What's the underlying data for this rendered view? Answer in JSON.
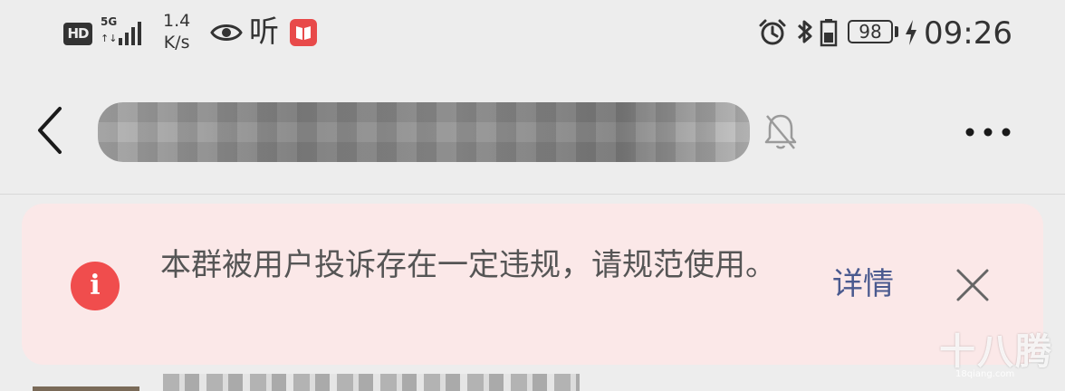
{
  "status_bar": {
    "hd_label": "HD",
    "network_label": "5G",
    "network_arrows": "↑↓",
    "net_speed_value": "1.4",
    "net_speed_unit": "K/s",
    "listen_label": "听",
    "battery_level": "98",
    "time": "09:26",
    "icons": [
      "hd-icon",
      "signal-icon",
      "eye-icon",
      "listen-icon",
      "book-app-icon",
      "alarm-icon",
      "bluetooth-icon",
      "battery-icon",
      "charging-icon"
    ]
  },
  "header": {
    "title": "",
    "back_icon": "chevron-left-icon",
    "mute_icon": "bell-off-icon",
    "more_label": "•••"
  },
  "banner": {
    "icon_glyph": "i",
    "message": "本群被用户投诉存在一定违规，请规范使用。",
    "detail_label": "详情",
    "close_icon": "close-icon",
    "colors": {
      "background": "#fbe8e8",
      "icon": "#f04d4d",
      "link": "#4a5a8f"
    }
  },
  "watermark": {
    "text": "十八腾",
    "sub": "18qiang.com"
  }
}
